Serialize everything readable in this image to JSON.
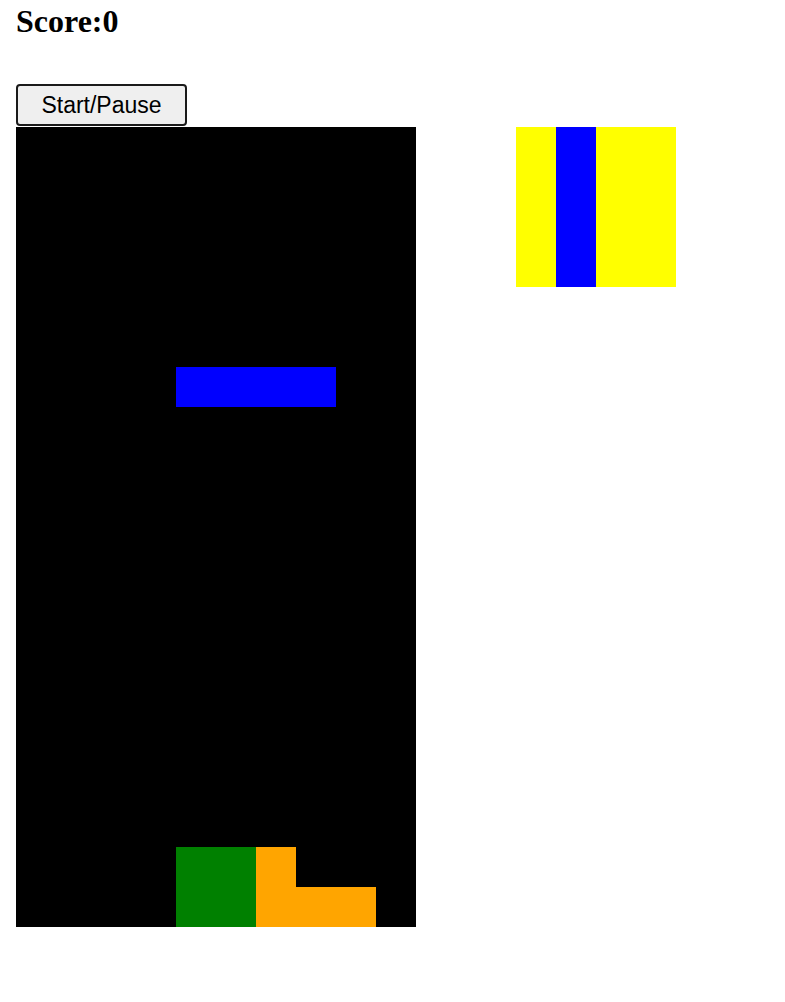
{
  "score": {
    "text": "Score:0"
  },
  "controls": {
    "start_pause": "Start/Pause"
  },
  "board": {
    "columns": 10,
    "rows": 20,
    "blocks": [
      {
        "row": 6,
        "col": 4,
        "color": "#0000ff"
      },
      {
        "row": 6,
        "col": 5,
        "color": "#0000ff"
      },
      {
        "row": 6,
        "col": 6,
        "color": "#0000ff"
      },
      {
        "row": 6,
        "col": 7,
        "color": "#0000ff"
      },
      {
        "row": 18,
        "col": 4,
        "color": "#008000"
      },
      {
        "row": 18,
        "col": 5,
        "color": "#008000"
      },
      {
        "row": 19,
        "col": 4,
        "color": "#008000"
      },
      {
        "row": 19,
        "col": 5,
        "color": "#008000"
      },
      {
        "row": 18,
        "col": 6,
        "color": "#ffa500"
      },
      {
        "row": 19,
        "col": 6,
        "color": "#ffa500"
      },
      {
        "row": 19,
        "col": 7,
        "color": "#ffa500"
      },
      {
        "row": 19,
        "col": 8,
        "color": "#ffa500"
      }
    ]
  },
  "next_piece": {
    "cells": [
      [
        "#ffff00",
        "#0000ff",
        "#ffff00",
        "#ffff00"
      ],
      [
        "#ffff00",
        "#0000ff",
        "#ffff00",
        "#ffff00"
      ],
      [
        "#ffff00",
        "#0000ff",
        "#ffff00",
        "#ffff00"
      ],
      [
        "#ffff00",
        "#0000ff",
        "#ffff00",
        "#ffff00"
      ]
    ]
  }
}
